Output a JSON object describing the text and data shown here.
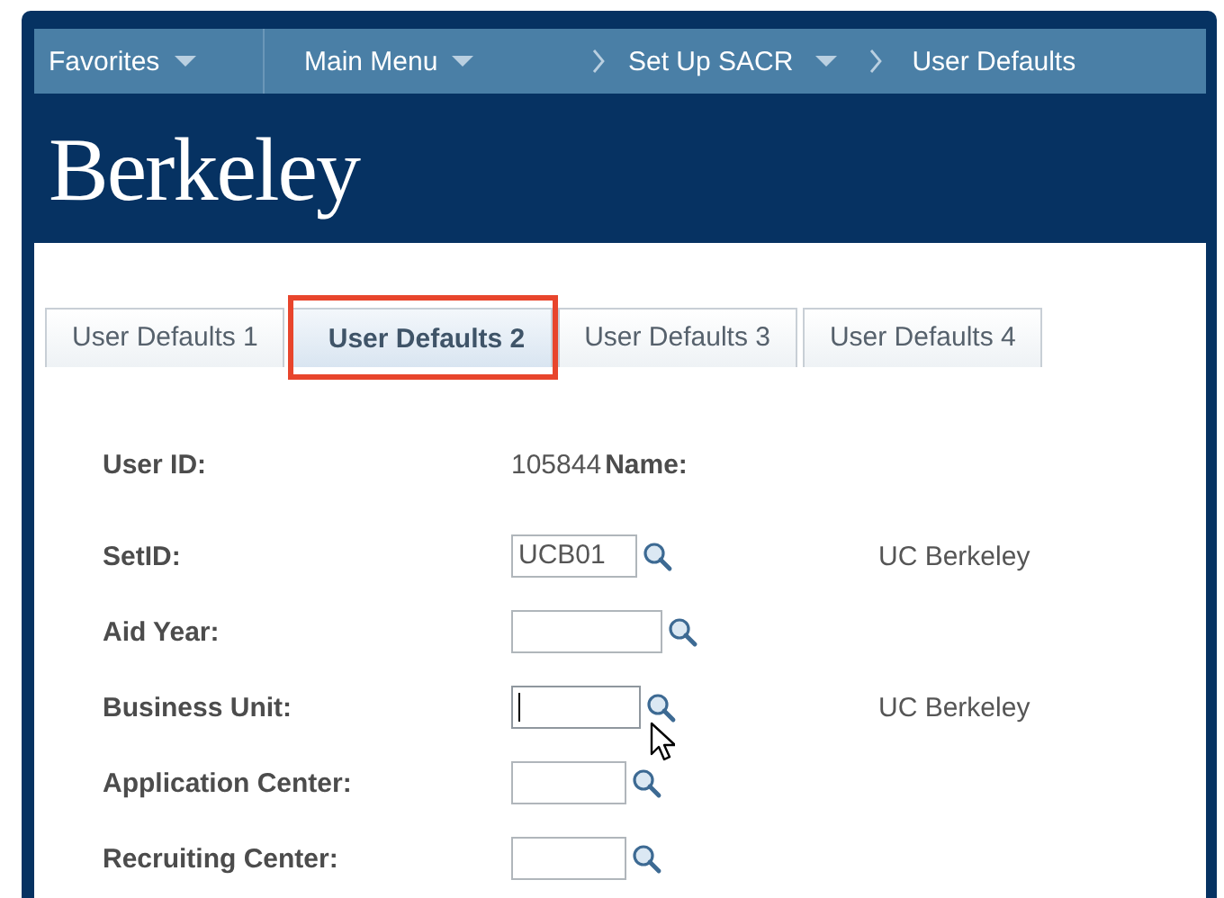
{
  "nav": [
    {
      "label": "Favorites",
      "kind": "menu"
    },
    {
      "label": "Main Menu",
      "kind": "menu"
    },
    {
      "label": "Set Up SACR",
      "kind": "crumb-menu"
    },
    {
      "label": "User Defaults",
      "kind": "crumb"
    }
  ],
  "logo": "Berkeley",
  "tabs": [
    {
      "label": "User Defaults 1",
      "selected": false,
      "highlighted": false
    },
    {
      "label": "User Defaults 2",
      "selected": true,
      "highlighted": true
    },
    {
      "label": "User Defaults 3",
      "selected": false,
      "highlighted": false
    },
    {
      "label": "User Defaults 4",
      "selected": false,
      "highlighted": false
    }
  ],
  "user": {
    "label": "User ID:",
    "value": "105844",
    "name_label": "Name:"
  },
  "fields": [
    {
      "label": "SetID:",
      "value": "UCB01",
      "focused": false,
      "description": "UC Berkeley"
    },
    {
      "label": "Aid Year:",
      "focused": false
    },
    {
      "label": "Business Unit:",
      "focused": true,
      "description": "UC Berkeley"
    },
    {
      "label": "Application Center:",
      "focused": false
    },
    {
      "label": "Recruiting Center:",
      "focused": false
    }
  ]
}
